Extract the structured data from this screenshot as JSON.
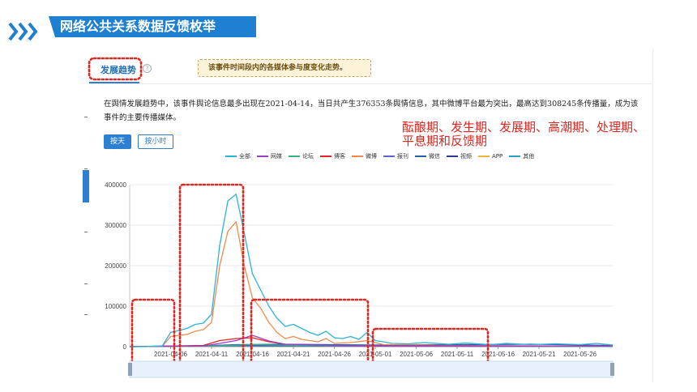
{
  "slide": {
    "title": "网络公共关系数据反馈枚举"
  },
  "panel": {
    "tab_label": "发展趋势",
    "help_icon_glyph": "?",
    "tip": "该事件时间段内的各媒体参与度变化走势。",
    "summary": "在舆情发展趋势中，该事件舆论信息最多出现在2021-04-14，当日共产生376353条舆情信息，其中微博平台最为突出，最高达到308245条传播量，成为该事件的主要传播媒体。",
    "btn_day": "按天",
    "btn_hour": "按小时",
    "phase_note": "酝酿期、发生期、发展期、高潮期、处理期、平息期和反馈期"
  },
  "colors": {
    "brand": "#1f7fd1",
    "annotation_red": "#e0261f"
  },
  "chart_data": {
    "type": "line",
    "title": "",
    "xlabel": "",
    "ylabel": "",
    "ylim": [
      0,
      400000
    ],
    "yticks": [
      "0",
      "100000",
      "200000",
      "300000",
      "400000"
    ],
    "x_start": "2021-04-01",
    "x_end": "2021-05-30",
    "xticks": [
      "2021-04-06",
      "2021-04-11",
      "2021-04-16",
      "2021-04-21",
      "2021-04-26",
      "2021-05-01",
      "2021-05-06",
      "2021-05-11",
      "2021-05-16",
      "2021-05-21",
      "2021-05-26"
    ],
    "grid": true,
    "legend_position": "top",
    "series": [
      {
        "name": "全部",
        "color": "#2cb3d6",
        "points": [
          [
            "2021-04-01",
            0
          ],
          [
            "2021-04-03",
            0
          ],
          [
            "2021-04-05",
            2000
          ],
          [
            "2021-04-06",
            35000
          ],
          [
            "2021-04-07",
            40000
          ],
          [
            "2021-04-08",
            45000
          ],
          [
            "2021-04-09",
            55000
          ],
          [
            "2021-04-10",
            58000
          ],
          [
            "2021-04-11",
            80000
          ],
          [
            "2021-04-12",
            250000
          ],
          [
            "2021-04-13",
            360000
          ],
          [
            "2021-04-14",
            376353
          ],
          [
            "2021-04-15",
            280000
          ],
          [
            "2021-04-16",
            180000
          ],
          [
            "2021-04-17",
            140000
          ],
          [
            "2021-04-18",
            100000
          ],
          [
            "2021-04-19",
            70000
          ],
          [
            "2021-04-20",
            50000
          ],
          [
            "2021-04-21",
            55000
          ],
          [
            "2021-04-22",
            45000
          ],
          [
            "2021-04-23",
            35000
          ],
          [
            "2021-04-24",
            28000
          ],
          [
            "2021-04-25",
            38000
          ],
          [
            "2021-04-26",
            22000
          ],
          [
            "2021-04-27",
            20000
          ],
          [
            "2021-04-28",
            25000
          ],
          [
            "2021-04-29",
            18000
          ],
          [
            "2021-04-30",
            35000
          ],
          [
            "2021-05-01",
            15000
          ],
          [
            "2021-05-02",
            12000
          ],
          [
            "2021-05-03",
            8000
          ],
          [
            "2021-05-05",
            7000
          ],
          [
            "2021-05-07",
            10000
          ],
          [
            "2021-05-10",
            6000
          ],
          [
            "2021-05-12",
            9000
          ],
          [
            "2021-05-15",
            5000
          ],
          [
            "2021-05-17",
            8000
          ],
          [
            "2021-05-20",
            5000
          ],
          [
            "2021-05-23",
            7000
          ],
          [
            "2021-05-26",
            5000
          ],
          [
            "2021-05-28",
            8000
          ],
          [
            "2021-05-30",
            4000
          ]
        ]
      },
      {
        "name": "网媒",
        "color": "#a13dc9",
        "points": [
          [
            "2021-04-01",
            0
          ],
          [
            "2021-04-10",
            2000
          ],
          [
            "2021-04-12",
            8000
          ],
          [
            "2021-04-14",
            15000
          ],
          [
            "2021-04-16",
            28000
          ],
          [
            "2021-04-18",
            14000
          ],
          [
            "2021-04-20",
            6000
          ],
          [
            "2021-04-24",
            4000
          ],
          [
            "2021-05-01",
            2000
          ],
          [
            "2021-05-30",
            1000
          ]
        ]
      },
      {
        "name": "论坛",
        "color": "#36b37e",
        "points": [
          [
            "2021-04-01",
            0
          ],
          [
            "2021-04-12",
            2000
          ],
          [
            "2021-04-16",
            5000
          ],
          [
            "2021-04-22",
            3000
          ],
          [
            "2021-04-30",
            2000
          ],
          [
            "2021-05-30",
            500
          ]
        ]
      },
      {
        "name": "博客",
        "color": "#e0261f",
        "points": [
          [
            "2021-04-01",
            0
          ],
          [
            "2021-04-10",
            3000
          ],
          [
            "2021-04-12",
            15000
          ],
          [
            "2021-04-14",
            20000
          ],
          [
            "2021-04-16",
            22000
          ],
          [
            "2021-04-18",
            12000
          ],
          [
            "2021-04-20",
            6000
          ],
          [
            "2021-04-24",
            3000
          ],
          [
            "2021-05-30",
            1000
          ]
        ]
      },
      {
        "name": "微博",
        "color": "#f08a4b",
        "points": [
          [
            "2021-04-01",
            0
          ],
          [
            "2021-04-05",
            1000
          ],
          [
            "2021-04-06",
            25000
          ],
          [
            "2021-04-07",
            28000
          ],
          [
            "2021-04-08",
            30000
          ],
          [
            "2021-04-09",
            38000
          ],
          [
            "2021-04-10",
            42000
          ],
          [
            "2021-04-11",
            60000
          ],
          [
            "2021-04-12",
            200000
          ],
          [
            "2021-04-13",
            285000
          ],
          [
            "2021-04-14",
            308245
          ],
          [
            "2021-04-15",
            200000
          ],
          [
            "2021-04-16",
            120000
          ],
          [
            "2021-04-17",
            95000
          ],
          [
            "2021-04-18",
            60000
          ],
          [
            "2021-04-19",
            35000
          ],
          [
            "2021-04-20",
            20000
          ],
          [
            "2021-04-21",
            25000
          ],
          [
            "2021-04-22",
            18000
          ],
          [
            "2021-04-23",
            15000
          ],
          [
            "2021-04-24",
            12000
          ],
          [
            "2021-04-25",
            20000
          ],
          [
            "2021-04-26",
            8000
          ],
          [
            "2021-04-28",
            10000
          ],
          [
            "2021-04-30",
            15000
          ],
          [
            "2021-05-02",
            5000
          ],
          [
            "2021-05-10",
            3000
          ],
          [
            "2021-05-30",
            1000
          ]
        ]
      },
      {
        "name": "报刊",
        "color": "#5b5fd6",
        "points": [
          [
            "2021-04-01",
            0
          ],
          [
            "2021-04-12",
            3000
          ],
          [
            "2021-04-16",
            4000
          ],
          [
            "2021-04-25",
            1500
          ],
          [
            "2021-05-30",
            500
          ]
        ]
      },
      {
        "name": "微信",
        "color": "#1f5fa8",
        "points": [
          [
            "2021-04-01",
            0
          ],
          [
            "2021-04-10",
            2000
          ],
          [
            "2021-04-14",
            5000
          ],
          [
            "2021-04-20",
            6000
          ],
          [
            "2021-05-01",
            4000
          ],
          [
            "2021-05-10",
            5000
          ],
          [
            "2021-05-20",
            6000
          ],
          [
            "2021-05-30",
            3000
          ]
        ]
      },
      {
        "name": "视频",
        "color": "#2b3a8f",
        "points": [
          [
            "2021-04-01",
            0
          ],
          [
            "2021-04-14",
            3000
          ],
          [
            "2021-04-24",
            2000
          ],
          [
            "2021-05-30",
            1000
          ]
        ]
      },
      {
        "name": "APP",
        "color": "#f3b43d",
        "points": [
          [
            "2021-04-01",
            0
          ],
          [
            "2021-04-14",
            4000
          ],
          [
            "2021-04-26",
            2000
          ],
          [
            "2021-05-30",
            1000
          ]
        ]
      },
      {
        "name": "其他",
        "color": "#2a9ec7",
        "points": [
          [
            "2021-04-01",
            0
          ],
          [
            "2021-04-14",
            2000
          ],
          [
            "2021-05-30",
            500
          ]
        ]
      }
    ]
  }
}
